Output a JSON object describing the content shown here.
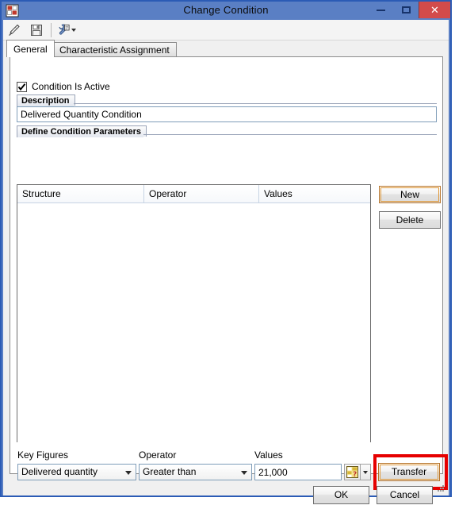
{
  "window": {
    "title": "Change Condition",
    "app_icon": "blocks-grid-icon",
    "controls": {
      "minimize": "minimize-icon",
      "maximize": "maximize-icon",
      "close": "✕"
    }
  },
  "toolbar": {
    "items": [
      {
        "icon": "pencil-edit-icon",
        "name": "edit-button"
      },
      {
        "icon": "floppy-save-icon",
        "name": "save-button"
      },
      {
        "icon": "wrench-settings-icon",
        "name": "settings-menu-button",
        "has_dropdown": true
      }
    ]
  },
  "tabs": [
    {
      "label": "General",
      "active": true
    },
    {
      "label": "Characteristic Assignment",
      "active": false
    }
  ],
  "general": {
    "condition_active": {
      "label": "Condition Is Active",
      "checked": true,
      "check_glyph": "✔"
    },
    "description_group": {
      "header": "Description",
      "value": "Delivered Quantity Condition",
      "placeholder": ""
    },
    "parameters_group": {
      "header": "Define Condition Parameters",
      "columns": [
        "Structure",
        "Operator",
        "Values"
      ],
      "rows": []
    },
    "side_buttons": {
      "new_label": "New",
      "delete_label": "Delete"
    },
    "editor_row": {
      "key_figures_label": "Key Figures",
      "key_figures_value": "Delivered quantity",
      "operator_label": "Operator",
      "operator_value": "Greater than",
      "values_label": "Values",
      "values_value": "21,000",
      "value_help_icon": "value-help-icon",
      "value_help_dropdown_icon": "chevron-down-icon",
      "transfer_label": "Transfer"
    }
  },
  "footer": {
    "ok_label": "OK",
    "cancel_label": "Cancel"
  },
  "annotation": {
    "highlight_color": "#e60000",
    "focus_color": "#e09a3c",
    "target": "transfer-button"
  }
}
